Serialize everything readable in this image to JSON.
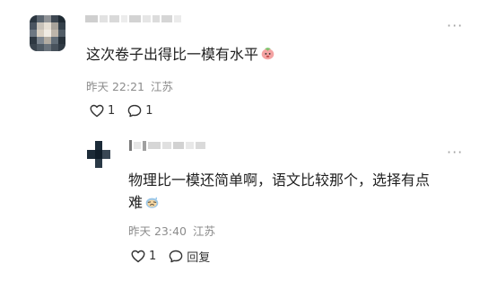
{
  "comment": {
    "text": "这次卷子出得比一模有水平",
    "time": "昨天 22:21",
    "location": "江苏",
    "like_count": "1",
    "reply_count": "1",
    "more_icon": "more-dots-icon",
    "emoji_icon": "peach-emoji-icon"
  },
  "reply": {
    "text_line1": "物理比一模还简单啊，语文比较那个，选择有点",
    "text_line2": "难",
    "time": "昨天 23:40",
    "location": "江苏",
    "like_count": "1",
    "reply_label": "回复",
    "more_icon": "more-dots-icon",
    "emoji_icon": "sweat-emoji-icon"
  }
}
